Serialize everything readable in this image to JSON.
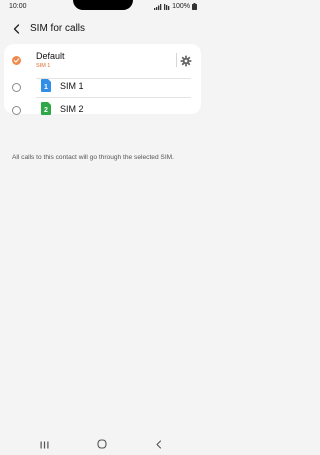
{
  "status_bar": {
    "time": "10:00",
    "battery": "100%",
    "icons": [
      "signal-icon",
      "wifi-icon",
      "battery-icon"
    ]
  },
  "header": {
    "title": "SIM for calls",
    "back_icon": "back-arrow-icon"
  },
  "options": [
    {
      "label": "Default",
      "sublabel": "SIM 1",
      "selected": true
    },
    {
      "label": "SIM 1",
      "icon": "sim-1-icon",
      "badge": "1",
      "color": "#2f8fe8",
      "selected": false
    },
    {
      "label": "SIM 2",
      "icon": "sim-2-icon",
      "badge": "2",
      "color": "#2fa84a",
      "selected": false
    }
  ],
  "info_text": "All calls to this contact will go through the selected SIM.",
  "colors": {
    "accent": "#f08a4b",
    "background": "#f4f4f4",
    "card": "#ffffff"
  },
  "nav": {
    "icons": [
      "recent-apps-icon",
      "home-icon",
      "back-icon"
    ]
  }
}
